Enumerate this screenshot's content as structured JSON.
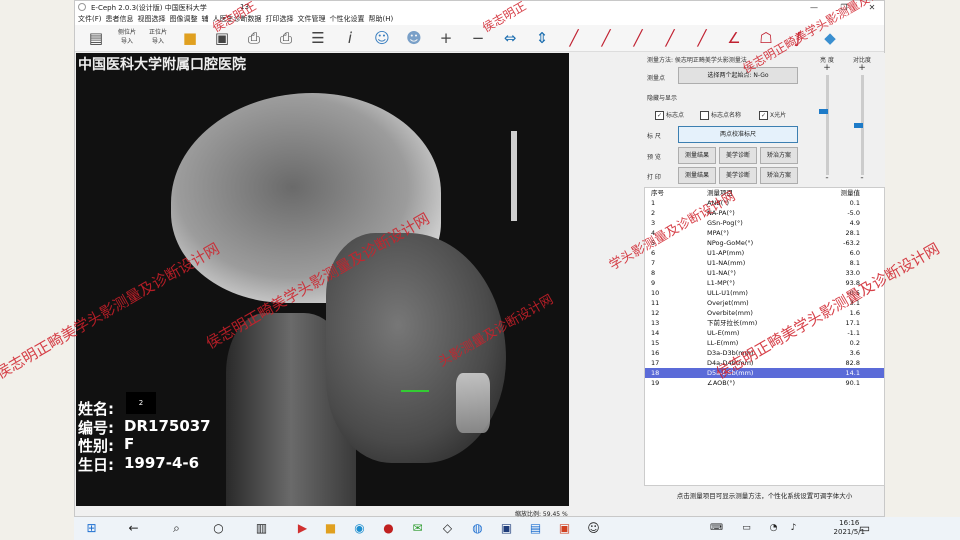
{
  "window": {
    "title": "E-Ceph 2.0.3(设计版)   中国医科大学",
    "title_extra": "13",
    "close": "✕",
    "maximize": "❐",
    "minimize": "—"
  },
  "menu": [
    "文件(F)",
    "患者信息",
    "视图选择",
    "图像调整",
    "辅",
    "人医生诊断数据",
    "打印选择",
    "文件管理",
    "个性化设置",
    "帮助(H)"
  ],
  "toolbar": {
    "lateral_import": "侧位片\n导入",
    "frontal_import": "正位片\n导入"
  },
  "xray": {
    "hospital": "中国医科大学附属口腔医院",
    "name_label": "姓名:",
    "name_box": "2",
    "id_label": "编号:",
    "id_value": "DR175037",
    "sex_label": "性别:",
    "sex_value": "F",
    "dob_label": "生日:",
    "dob_value": "1997-4-6",
    "zoom_text": "缩放比例: 59.45 %"
  },
  "panel": {
    "method": "测量方法: 侯志明正畸美学头影测量法",
    "measure_point_label": "测量点",
    "select_points_button": "选择两个起始点: N-Go",
    "display_label": "隐藏与显示",
    "chk_marker": "标志点",
    "chk_marker_name": "标志点名称",
    "chk_xray": "X光片",
    "ruler_label": "标 尺",
    "ruler_button": "两点校准标尺",
    "preview_label": "预 览",
    "print_label": "打 印",
    "btn_result": "测量结果",
    "btn_aesthetic": "美学诊断",
    "btn_plan": "矫治方案",
    "contrast_label": "亮 度",
    "brightness_label": "对比度",
    "plus": "+",
    "minus": "-"
  },
  "table": {
    "headers": [
      "序号",
      "测量项目",
      "测量值"
    ],
    "rows": [
      [
        "1",
        "ANB(°)",
        "0.1"
      ],
      [
        "2",
        "NA-PA(°)",
        "-5.0"
      ],
      [
        "3",
        "GSn-Pog(°)",
        "4.9"
      ],
      [
        "4",
        "MPA(°)",
        "28.1"
      ],
      [
        "5",
        "NPog-GoMe(°)",
        "-63.2"
      ],
      [
        "6",
        "U1-AP(mm)",
        "6.0"
      ],
      [
        "7",
        "U1-NA(mm)",
        "8.1"
      ],
      [
        "8",
        "U1-NA(°)",
        "33.0"
      ],
      [
        "9",
        "L1-MP(°)",
        "93.8"
      ],
      [
        "10",
        "ULL-U1(mm)",
        "-0.5"
      ],
      [
        "11",
        "Overjet(mm)",
        "3.1"
      ],
      [
        "12",
        "Overbite(mm)",
        "1.6"
      ],
      [
        "13",
        "下前牙拉长(mm)",
        "17.1"
      ],
      [
        "14",
        "UL-E(mm)",
        "-1.1"
      ],
      [
        "15",
        "LL-E(mm)",
        "0.2"
      ],
      [
        "16",
        "D3a-D3b(mm)",
        "3.6"
      ],
      [
        "17",
        "D4a-D4b(mm)",
        "82.8"
      ],
      [
        "18",
        "D5a-D5b(mm)",
        "14.1"
      ],
      [
        "19",
        "∠AOB(°)",
        "90.1"
      ]
    ],
    "selected_row": 18
  },
  "hint": "点击测量项目可显示测量方法，个性化系统设置可调字体大小",
  "taskbar": {
    "time": "16:16",
    "date": "2021/5/1"
  },
  "watermarks": [
    "侯志明正",
    "侯志明正",
    "侯志明正畸美学头影测量及诊断设计网",
    "侯志明正畸美学头影测量及诊断设计网",
    "头影测量及诊断设计网",
    "学头影测量及诊断设计网",
    "侯志明正畸美学头影测量及诊断设计网",
    "侯志明正畸美学头影测量及诊断设计网"
  ]
}
